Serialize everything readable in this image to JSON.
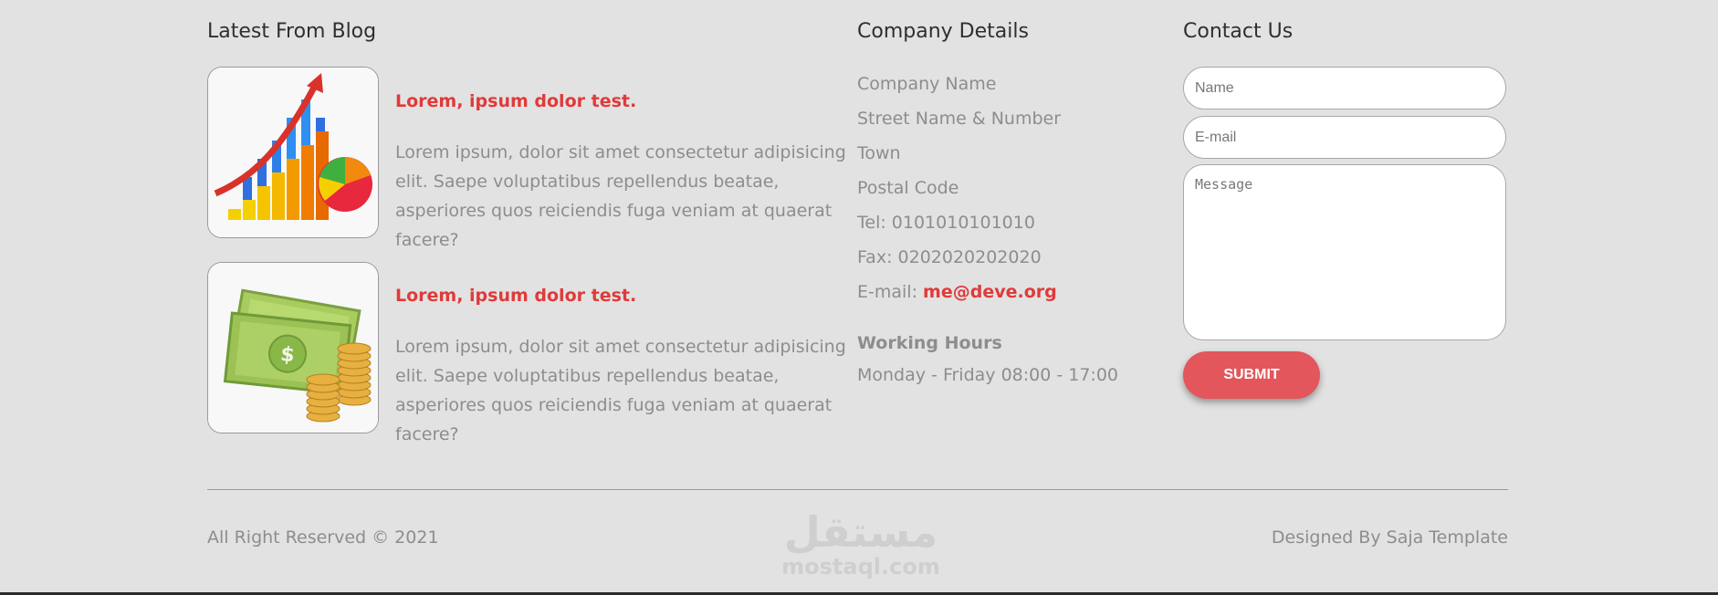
{
  "blog": {
    "title": "Latest From Blog",
    "posts": [
      {
        "title": "Lorem, ipsum dolor test.",
        "text": "Lorem ipsum, dolor sit amet consectetur adipisicing elit. Saepe voluptatibus repellendus beatae, asperiores quos reiciendis fuga veniam at quaerat facere?",
        "image_icon": "growth-chart-icon"
      },
      {
        "title": "Lorem, ipsum dolor test.",
        "text": "Lorem ipsum, dolor sit amet consectetur adipisicing elit. Saepe voluptatibus repellendus beatae, asperiores quos reiciendis fuga veniam at quaerat facere?",
        "image_icon": "money-icon"
      }
    ]
  },
  "company": {
    "title": "Company Details",
    "name": "Company Name",
    "street": "Street Name & Number",
    "town": "Town",
    "postal": "Postal Code",
    "tel": "Tel: 0101010101010",
    "fax": "Fax: 0202020202020",
    "email_label": "E-mail:",
    "email_value": "me@deve.org",
    "hours_title": "Working Hours",
    "hours_text": "Monday - Friday 08:00 - 17:00"
  },
  "contact": {
    "title": "Contact Us",
    "name_placeholder": "Name",
    "email_placeholder": "E-mail",
    "message_placeholder": "Message",
    "submit_label": "SUBMIT"
  },
  "footer": {
    "left": "All Right Reserved © 2021",
    "right": "Designed By Saja Template"
  },
  "watermark": {
    "arabic": "مستقل",
    "latin": "mostaql.com"
  },
  "colors": {
    "background": "#e2e2e2",
    "accent": "#e03a3a",
    "button": "#e3565b",
    "muted_text": "#8d8d8d"
  }
}
